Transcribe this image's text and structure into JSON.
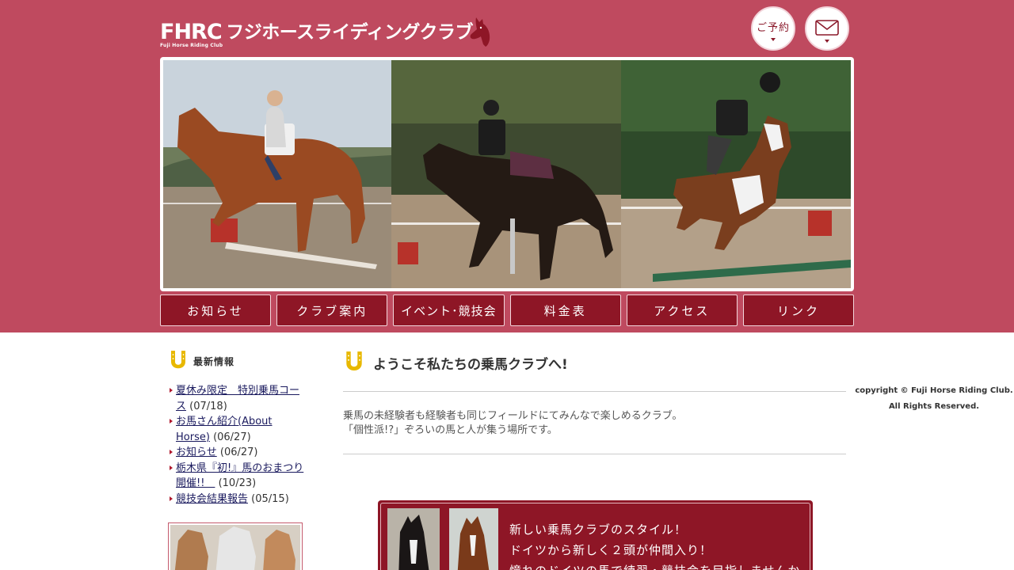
{
  "header": {
    "logo_mark": "FHRC",
    "logo_sub": "Fuji Horse Riding Club",
    "logo_name": "フジホースライディングクラブ",
    "reserve_label": "ご予約"
  },
  "nav": {
    "items": [
      {
        "label": "お知らせ"
      },
      {
        "label": "クラブ案内"
      },
      {
        "label": "イベント･競技会"
      },
      {
        "label": "料金表"
      },
      {
        "label": "アクセス"
      },
      {
        "label": "リンク"
      }
    ]
  },
  "sidebar": {
    "title": "最新情報",
    "news": [
      {
        "title": "夏休み限定　特別乗馬コース",
        "date": "(07/18)"
      },
      {
        "title": "お馬さん紹介(About Horse)",
        "date": "(06/27)"
      },
      {
        "title": "お知らせ",
        "date": "(06/27)"
      },
      {
        "title": "栃木県『初!』馬のおまつり開催!!　",
        "date": "(10/23)"
      },
      {
        "title": "競技会結果報告",
        "date": "(05/15)"
      }
    ]
  },
  "main": {
    "title": "ようこそ私たちの乗馬クラブへ!",
    "intro_line1": "乗馬の未経験者も経験者も同じフィールドにてみんなで楽しめるクラブ。",
    "intro_line2": "「個性派!?」ぞろいの馬と人が集う場所です。"
  },
  "promo": {
    "line1": "新しい乗馬クラブのスタイル！",
    "line2": "ドイツから新しく２頭が仲間入り！",
    "line3": "憧れのドイツの馬で練習・競技会を目指しませんか"
  },
  "footer": {
    "copyright_line1": "copyright © Fuji Horse Riding Club.",
    "copyright_line2": "All Rights Reserved."
  },
  "colors": {
    "header_band": "#bf4a5f",
    "nav_button": "#8e1626",
    "accent_gold": "#e8b800",
    "link": "#1a1a5e"
  },
  "icons": [
    "horse-head-icon",
    "horseshoe-icon",
    "mail-icon",
    "dropdown-triangle-icon"
  ]
}
